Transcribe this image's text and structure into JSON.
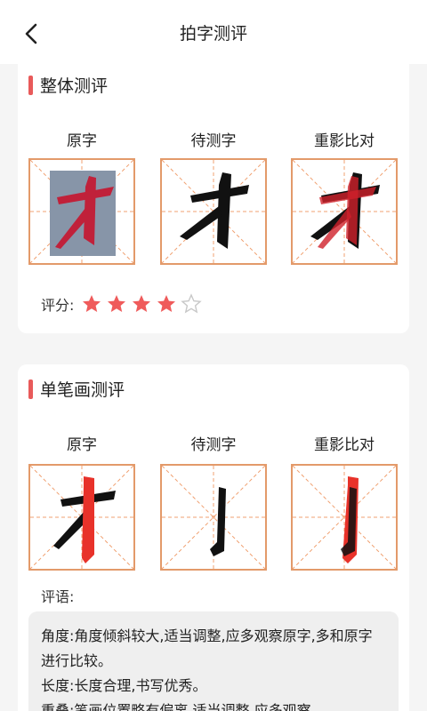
{
  "header": {
    "title": "拍字测评",
    "back_icon": "chevron-left-icon"
  },
  "overall": {
    "title": "整体测评",
    "labels": [
      "原字",
      "待测字",
      "重影比对"
    ],
    "rating_label": "评分:",
    "rating": 4,
    "rating_max": 5
  },
  "stroke": {
    "title": "单笔画测评",
    "labels": [
      "原字",
      "待测字",
      "重影比对"
    ],
    "comment_label": "评语:",
    "comments": [
      "角度:角度倾斜较大,适当调整,应多观察原字,多和原字进行比较。",
      "长度:长度合理,书写优秀。",
      "重叠:笔画位置略有偏离,适当调整,应多观察"
    ]
  },
  "colors": {
    "accent": "#e85a5a",
    "grid_border": "#e39a6a",
    "guide": "#f0a070",
    "star_on": "#ef5b5b",
    "star_off": "#c8c8c8"
  }
}
